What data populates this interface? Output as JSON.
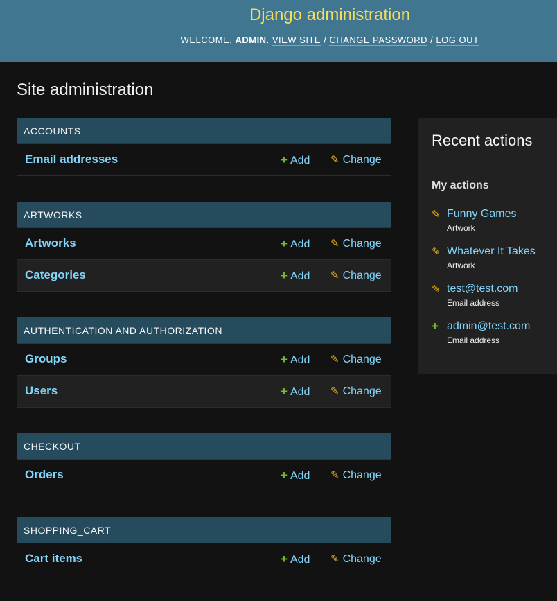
{
  "header": {
    "site_name": "Django administration",
    "welcome_prefix": "Welcome,",
    "username": "admin",
    "period": ".",
    "view_site": "View site",
    "separator": "/",
    "change_password": "Change password",
    "log_out": "Log out"
  },
  "page_title": "Site administration",
  "modules": [
    {
      "caption": "Accounts",
      "models": [
        {
          "name": "Email addresses",
          "add": "Add",
          "change": "Change"
        }
      ]
    },
    {
      "caption": "Artworks",
      "models": [
        {
          "name": "Artworks",
          "add": "Add",
          "change": "Change"
        },
        {
          "name": "Categories",
          "add": "Add",
          "change": "Change"
        }
      ]
    },
    {
      "caption": "Authentication and Authorization",
      "models": [
        {
          "name": "Groups",
          "add": "Add",
          "change": "Change"
        },
        {
          "name": "Users",
          "add": "Add",
          "change": "Change"
        }
      ]
    },
    {
      "caption": "Checkout",
      "models": [
        {
          "name": "Orders",
          "add": "Add",
          "change": "Change"
        }
      ]
    },
    {
      "caption": "Shopping_cart",
      "models": [
        {
          "name": "Cart items",
          "add": "Add",
          "change": "Change"
        }
      ]
    }
  ],
  "recent_actions": {
    "title": "Recent actions",
    "subtitle": "My actions",
    "items": [
      {
        "icon": "pencil-icon",
        "label": "Funny Games",
        "type": "Artwork"
      },
      {
        "icon": "pencil-icon",
        "label": "Whatever It Takes",
        "type": "Artwork"
      },
      {
        "icon": "pencil-icon",
        "label": "test@test.com",
        "type": "Email address"
      },
      {
        "icon": "plus-icon",
        "label": "admin@test.com",
        "type": "Email address"
      }
    ]
  },
  "colors": {
    "header_bg": "#417690",
    "site_name": "#f5dd5d",
    "caption_bg": "#264b5d",
    "link": "#81d4fa",
    "add_icon": "#70bf2b",
    "change_icon": "#efb80b",
    "page_bg": "#121212",
    "panel_bg": "#212121"
  }
}
